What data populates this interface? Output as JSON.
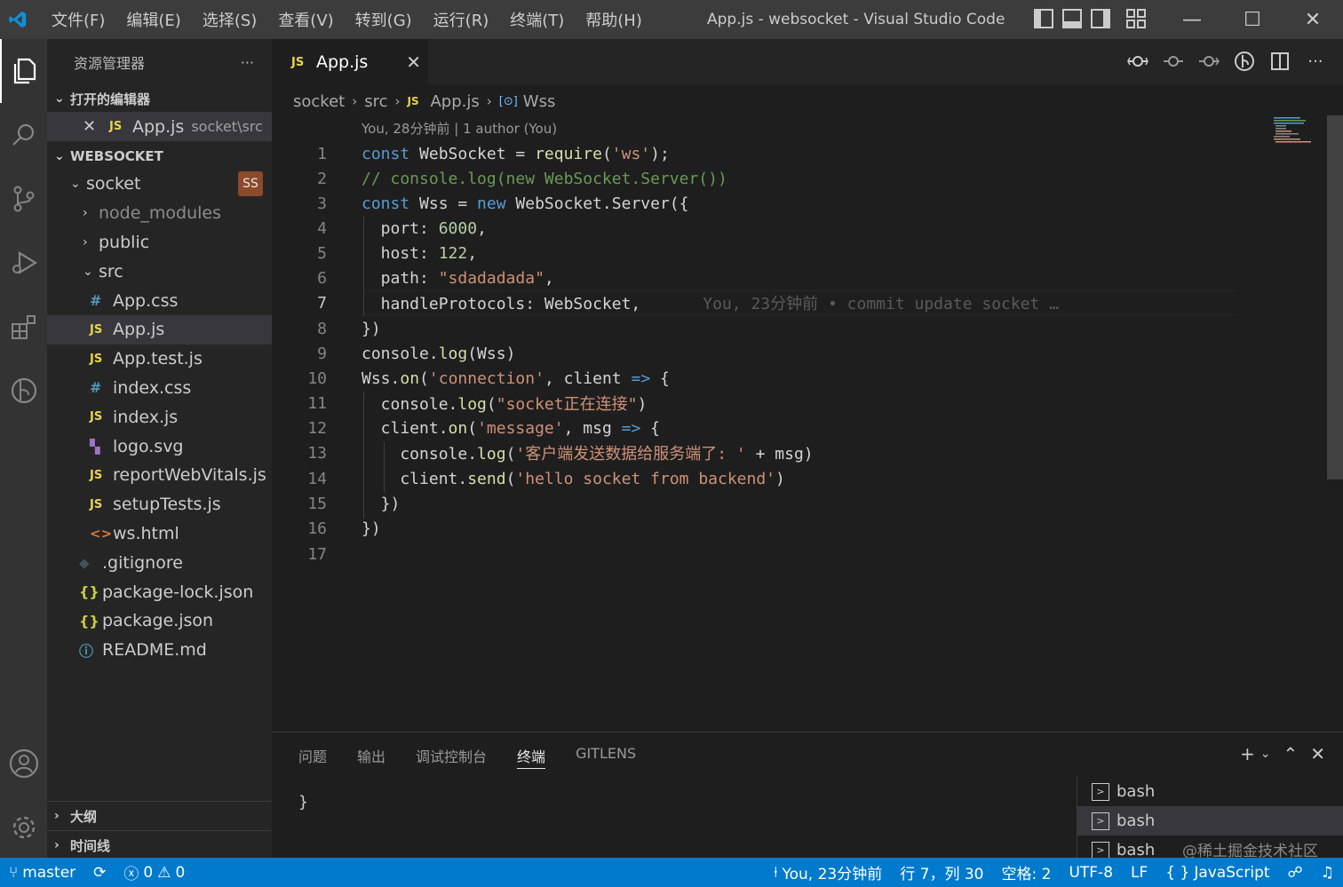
{
  "titlebar": {
    "menus": [
      "文件(F)",
      "编辑(E)",
      "选择(S)",
      "查看(V)",
      "转到(G)",
      "运行(R)",
      "终端(T)",
      "帮助(H)"
    ],
    "title": "App.js - websocket - Visual Studio Code",
    "min": "—",
    "max": "☐",
    "close": "✕"
  },
  "sidebar": {
    "header": "资源管理器",
    "more": "···",
    "open_editors": "打开的编辑器",
    "open_file": {
      "icon": "JS",
      "name": "App.js",
      "path": "socket\\src"
    },
    "workspace": "WEBSOCKET",
    "tree": [
      {
        "name": "socket",
        "type": "folder",
        "open": true,
        "badge": "SS"
      },
      {
        "name": "node_modules",
        "type": "folder",
        "open": false
      },
      {
        "name": "public",
        "type": "folder",
        "open": false
      },
      {
        "name": "src",
        "type": "folder",
        "open": true
      },
      {
        "name": "App.css",
        "icon": "#"
      },
      {
        "name": "App.js",
        "icon": "JS",
        "selected": true
      },
      {
        "name": "App.test.js",
        "icon": "JS"
      },
      {
        "name": "index.css",
        "icon": "#"
      },
      {
        "name": "index.js",
        "icon": "JS"
      },
      {
        "name": "logo.svg",
        "icon": "svg"
      },
      {
        "name": "reportWebVitals.js",
        "icon": "JS"
      },
      {
        "name": "setupTests.js",
        "icon": "JS"
      },
      {
        "name": "ws.html",
        "icon": "<>"
      },
      {
        "name": ".gitignore",
        "icon": "git"
      },
      {
        "name": "package-lock.json",
        "icon": "{}"
      },
      {
        "name": "package.json",
        "icon": "{}"
      },
      {
        "name": "README.md",
        "icon": "i"
      }
    ],
    "outline": "大纲",
    "timeline": "时间线"
  },
  "tab": {
    "icon": "JS",
    "label": "App.js",
    "close": "✕"
  },
  "breadcrumb": {
    "items": [
      "socket",
      "src",
      "App.js",
      "Wss"
    ],
    "file_icon": "JS",
    "symbol_icon": "[⊙]"
  },
  "codelens": "You, 28分钟前 | 1 author (You)",
  "code": {
    "line_numbers": [
      "1",
      "2",
      "3",
      "4",
      "5",
      "6",
      "7",
      "8",
      "9",
      "10",
      "11",
      "12",
      "13",
      "14",
      "15",
      "16",
      "17"
    ],
    "blame_line7": "You, 23分钟前 • commit update socket …"
  },
  "panel": {
    "tabs": [
      "问题",
      "输出",
      "调试控制台",
      "终端",
      "GITLENS"
    ],
    "active_tab": "终端",
    "terminal_text": "}",
    "terminals": [
      "bash",
      "bash",
      "bash"
    ],
    "watermark": "@稀土掘金技术社区"
  },
  "statusbar": {
    "branch": "master",
    "sync": "⟳",
    "errors": "0",
    "warnings": "0",
    "blame": "You, 23分钟前",
    "position": "行 7，列 30",
    "spaces": "空格: 2",
    "encoding": "UTF-8",
    "eol": "LF",
    "language": "JavaScript"
  }
}
